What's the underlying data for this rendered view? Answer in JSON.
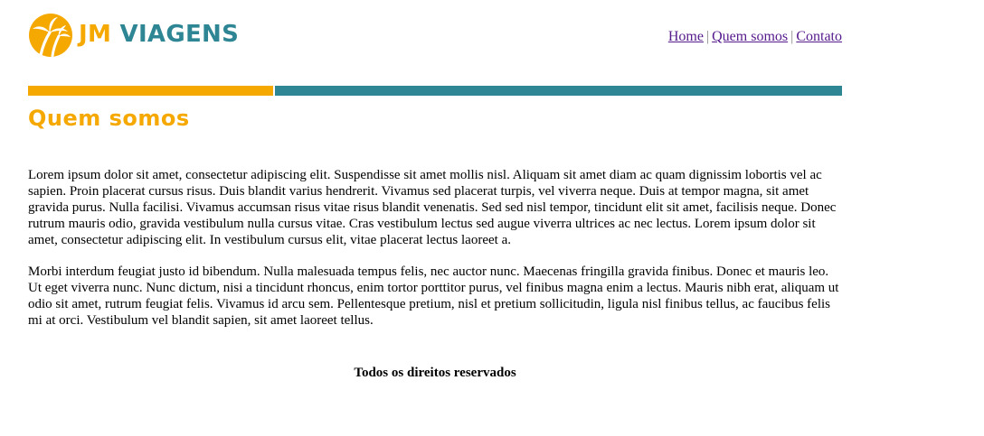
{
  "header": {
    "logo_first": "JM",
    "logo_second": "VIAGENS",
    "nav": {
      "home": "Home",
      "sep1": "|",
      "about": "Quem somos",
      "sep2": "|",
      "contact": "Contato"
    }
  },
  "colors": {
    "brand_orange": "#f5a800",
    "brand_teal": "#2e8593",
    "link_visited": "#551a8b"
  },
  "icons": {
    "logo": "palm-tree-sun-icon"
  },
  "main": {
    "title": "Quem somos",
    "paragraphs": [
      "Lorem ipsum dolor sit amet, consectetur adipiscing elit. Suspendisse sit amet mollis nisl. Aliquam sit amet diam ac quam dignissim lobortis vel ac sapien. Proin placerat cursus risus. Duis blandit varius hendrerit. Vivamus sed placerat turpis, vel viverra neque. Duis at tempor magna, sit amet gravida purus. Nulla facilisi. Vivamus accumsan risus vitae risus blandit venenatis. Sed sed nisl tempor, tincidunt elit sit amet, facilisis neque. Donec rutrum mauris odio, gravida vestibulum nulla cursus vitae. Cras vestibulum lectus sed augue viverra ultrices ac nec lectus. Lorem ipsum dolor sit amet, consectetur adipiscing elit. In vestibulum cursus elit, vitae placerat lectus laoreet a.",
      "Morbi interdum feugiat justo id bibendum. Nulla malesuada tempus felis, nec auctor nunc. Maecenas fringilla gravida finibus. Donec et mauris leo. Ut eget viverra nunc. Nunc dictum, nisi a tincidunt rhoncus, enim tortor porttitor purus, vel finibus magna enim a lectus. Mauris nibh erat, aliquam ut odio sit amet, rutrum feugiat felis. Vivamus id arcu sem. Pellentesque pretium, nisl et pretium sollicitudin, ligula nisl finibus tellus, ac faucibus felis mi at orci. Vestibulum vel blandit sapien, sit amet laoreet tellus."
    ]
  },
  "footer": {
    "text": "Todos os direitos reservados"
  }
}
